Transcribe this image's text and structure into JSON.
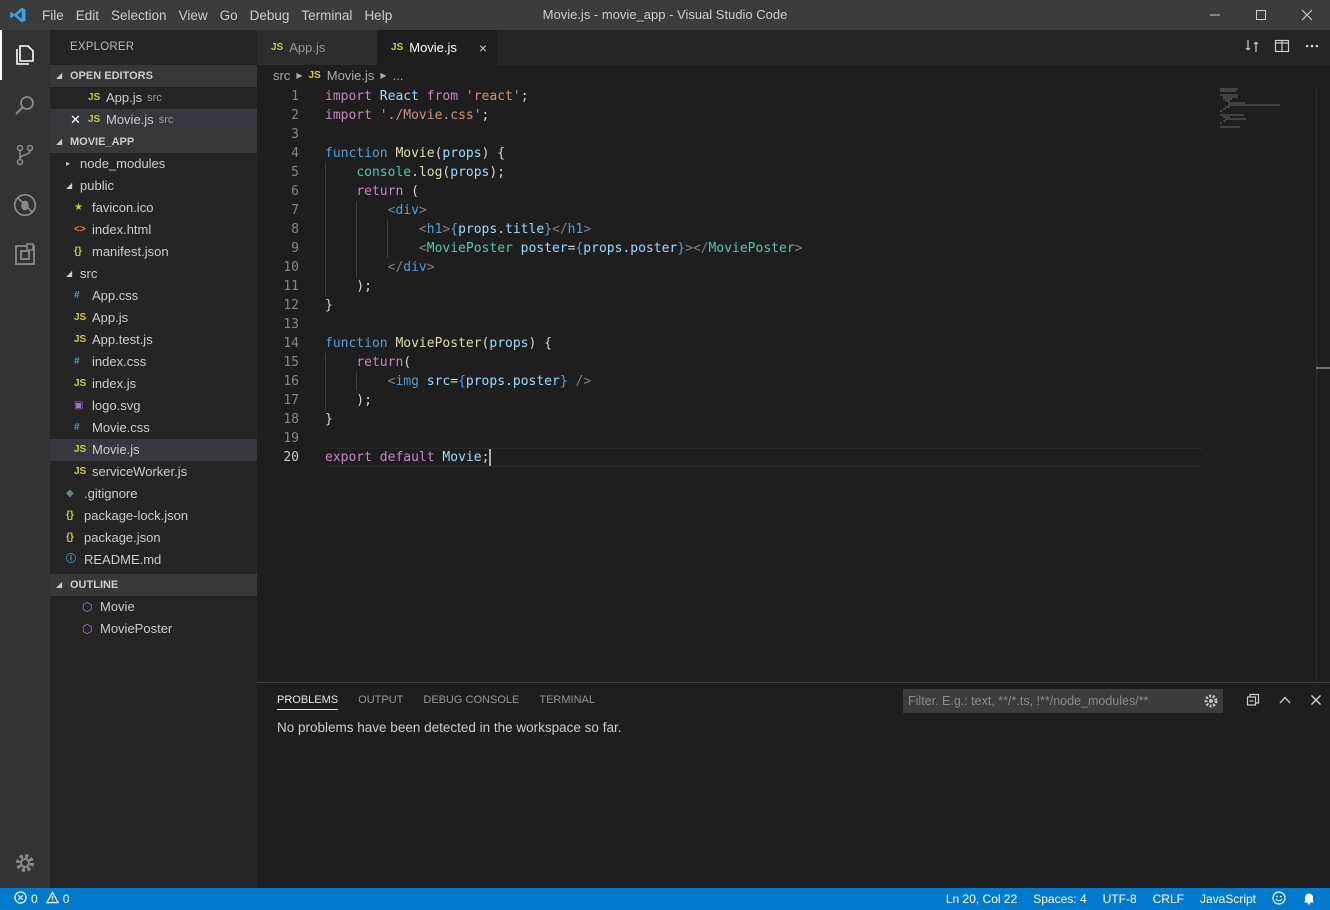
{
  "window": {
    "title": "Movie.js - movie_app - Visual Studio Code",
    "menu": [
      "File",
      "Edit",
      "Selection",
      "View",
      "Go",
      "Debug",
      "Terminal",
      "Help"
    ]
  },
  "sidebar": {
    "header": "EXPLORER",
    "open_editors": {
      "title": "OPEN EDITORS",
      "items": [
        {
          "icon": "JS",
          "name": "App.js",
          "desc": "src"
        },
        {
          "icon": "JS",
          "name": "Movie.js",
          "desc": "src"
        }
      ]
    },
    "project": {
      "title": "MOVIE_APP",
      "items": [
        {
          "icon": "›",
          "name": "node_modules"
        },
        {
          "icon": "⌄",
          "name": "public"
        },
        {
          "icon": "★",
          "name": "favicon.ico"
        },
        {
          "icon": "<>",
          "name": "index.html"
        },
        {
          "icon": "{}",
          "name": "manifest.json"
        },
        {
          "icon": "⌄",
          "name": "src"
        },
        {
          "icon": "#",
          "name": "App.css"
        },
        {
          "icon": "JS",
          "name": "App.js"
        },
        {
          "icon": "JS",
          "name": "App.test.js"
        },
        {
          "icon": "#",
          "name": "index.css"
        },
        {
          "icon": "JS",
          "name": "index.js"
        },
        {
          "icon": "▣",
          "name": "logo.svg"
        },
        {
          "icon": "#",
          "name": "Movie.css"
        },
        {
          "icon": "JS",
          "name": "Movie.js"
        },
        {
          "icon": "JS",
          "name": "serviceWorker.js"
        },
        {
          "icon": "◆",
          "name": ".gitignore"
        },
        {
          "icon": "{}",
          "name": "package-lock.json"
        },
        {
          "icon": "{}",
          "name": "package.json"
        },
        {
          "icon": "ⓘ",
          "name": "README.md"
        }
      ]
    },
    "outline": {
      "title": "OUTLINE",
      "items": [
        "Movie",
        "MoviePoster"
      ]
    }
  },
  "editor": {
    "tabs": [
      {
        "icon": "JS",
        "label": "App.js"
      },
      {
        "icon": "JS",
        "label": "Movie.js",
        "close": "×"
      }
    ],
    "breadcrumb": {
      "folder": "src",
      "icon": "JS",
      "file": "Movie.js",
      "more": "..."
    },
    "line_numbers": [
      "1",
      "2",
      "3",
      "4",
      "5",
      "6",
      "7",
      "8",
      "9",
      "10",
      "11",
      "12",
      "13",
      "14",
      "15",
      "16",
      "17",
      "18",
      "19",
      "20"
    ],
    "cursor": {
      "line": 20,
      "col": 22
    }
  },
  "panel": {
    "tabs": [
      "PROBLEMS",
      "OUTPUT",
      "DEBUG CONSOLE",
      "TERMINAL"
    ],
    "filter_placeholder": "Filter. E.g.: text, **/*.ts, !**/node_modules/**",
    "message": "No problems have been detected in the workspace so far."
  },
  "statusbar": {
    "errors": "0",
    "warnings": "0",
    "position": "Ln 20, Col 22",
    "spaces": "Spaces: 4",
    "encoding": "UTF-8",
    "eol": "CRLF",
    "language": "JavaScript"
  },
  "colors": {
    "accent": "#007acc",
    "activity_bar": "#333333",
    "sidebar": "#252526",
    "editor_bg": "#1e1e1e"
  }
}
